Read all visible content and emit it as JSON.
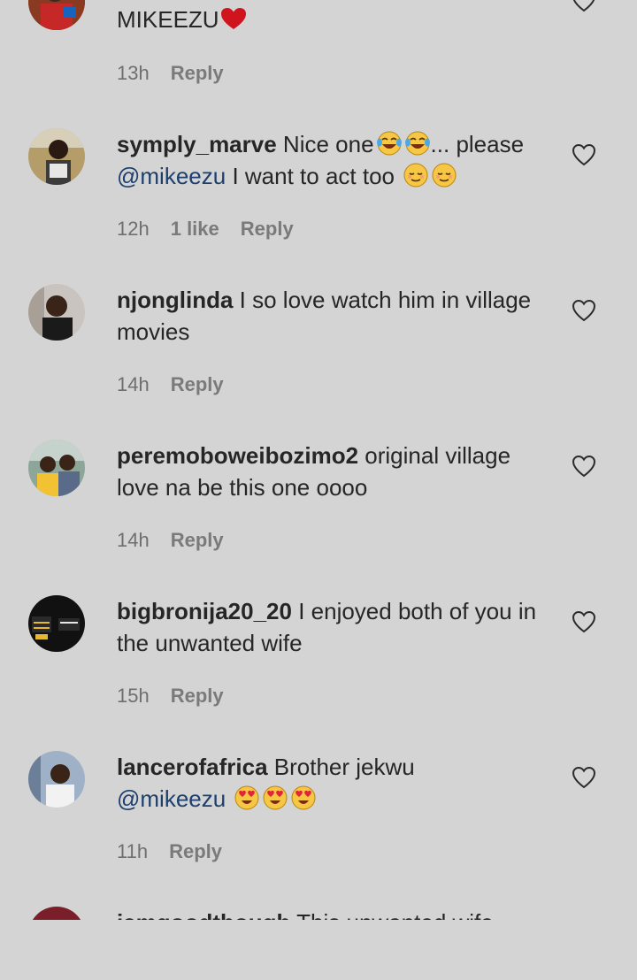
{
  "comments": [
    {
      "text": "MIKEEZU",
      "time": "13h",
      "reply": "Reply"
    },
    {
      "user": "symply_marve",
      "text1": "Nice one",
      "text2": "... please",
      "mention": "@mikeezu",
      "text3": "I want to act too",
      "time": "12h",
      "likes": "1 like",
      "reply": "Reply"
    },
    {
      "user": "njonglinda",
      "text": "I so love watch him in village movies",
      "time": "14h",
      "reply": "Reply"
    },
    {
      "user": "peremoboweibozimo2",
      "text": "original village love na be this one oooo",
      "time": "14h",
      "reply": "Reply"
    },
    {
      "user": "bigbronija20_20",
      "text": "I enjoyed both of you in the unwanted wife",
      "time": "15h",
      "reply": "Reply"
    },
    {
      "user": "lancerofafrica",
      "text": "Brother jekwu",
      "mention": "@mikeezu",
      "time": "11h",
      "reply": "Reply"
    },
    {
      "user": "iamgoodthough",
      "text": "This unwanted wife"
    }
  ],
  "icons": {
    "like": "heart-outline-icon",
    "red_heart": "red-heart-emoji",
    "laugh": "tears-of-joy-emoji",
    "relieved": "relieved-face-emoji",
    "heart_eyes": "heart-eyes-emoji"
  },
  "colors": {
    "background": "#d4d4d4",
    "text": "#262626",
    "meta": "#6f6f6f",
    "mention": "#1d3f6e",
    "red_heart": "#d0141d"
  }
}
